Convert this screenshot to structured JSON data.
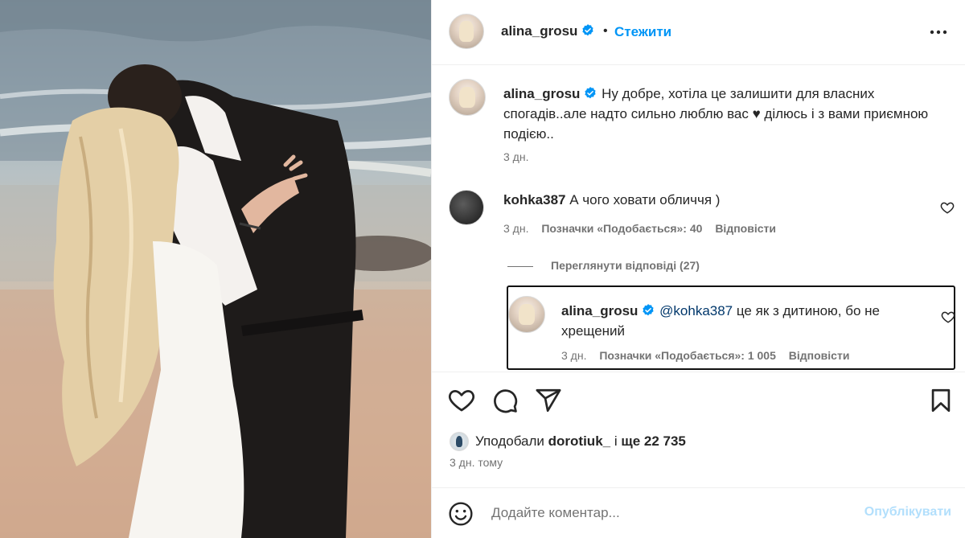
{
  "header": {
    "username": "alina_grosu",
    "separator": "•",
    "follow_label": "Стежити"
  },
  "caption": {
    "username": "alina_grosu",
    "text": "Ну добре, хотіла це залишити для власних спогадів..але надто сильно люблю вас ♥ ділюсь і з вами приємною подією..",
    "time": "3 дн."
  },
  "comment": {
    "username": "kohka387",
    "text": "А чого ховати обличчя )",
    "time": "3 дн.",
    "likes": "Позначки «Подобається»: 40",
    "reply_label": "Відповісти"
  },
  "view_replies": "Переглянути відповіді (27)",
  "reply": {
    "username": "alina_grosu",
    "mention": "@kohka387",
    "text": "це як з дитиною, бо не хрещений",
    "time": "3 дн.",
    "likes": "Позначки «Подобається»: 1 005",
    "reply_label": "Відповісти"
  },
  "likes": {
    "prefix": "Уподобали",
    "user": "dorotiuk_",
    "connector": "і",
    "rest": "ще 22 735"
  },
  "posted_time": "3 дн. тому",
  "comment_box": {
    "placeholder": "Додайте коментар...",
    "publish_label": "Опублікувати"
  },
  "colors": {
    "accent": "#0095f6",
    "verified": "#0095f6",
    "publish_disabled": "#b2dffc",
    "mention": "#00376b"
  },
  "icons": [
    "verified-badge-icon",
    "more-options-icon",
    "heart-icon",
    "comment-icon",
    "share-icon",
    "bookmark-icon",
    "emoji-icon"
  ]
}
